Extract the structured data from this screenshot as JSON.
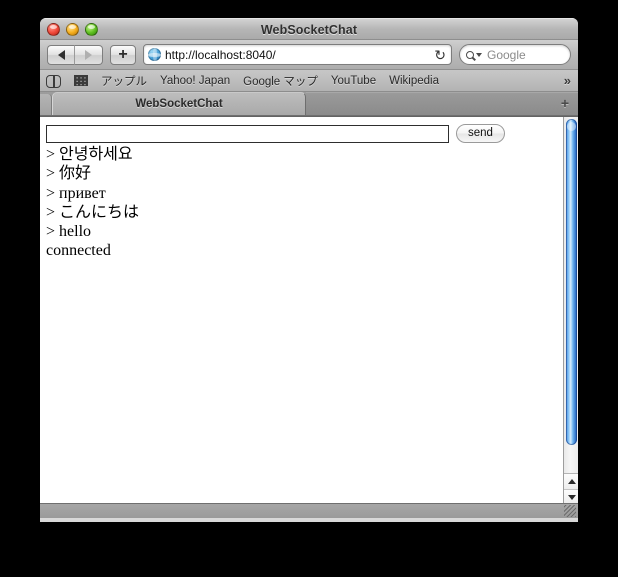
{
  "window": {
    "title": "WebSocketChat",
    "controls": {
      "close": "close-button",
      "minimize": "minimize-button",
      "zoom": "zoom-button"
    }
  },
  "toolbar": {
    "back_label": "◀",
    "forward_label": "▶",
    "add_bookmark_label": "+",
    "url": "http://localhost:8040/",
    "reload_label": "↻",
    "search_placeholder": "Google"
  },
  "bookmarks_bar": {
    "icons": [
      "book-icon",
      "grid-icon"
    ],
    "items": [
      {
        "label": "アップル"
      },
      {
        "label": "Yahoo! Japan"
      },
      {
        "label": "Google マップ"
      },
      {
        "label": "YouTube"
      },
      {
        "label": "Wikipedia"
      }
    ],
    "overflow_label": "»"
  },
  "tabs": {
    "active": {
      "label": "WebSocketChat"
    },
    "new_tab_label": "+"
  },
  "page": {
    "input_value": "",
    "input_placeholder": "",
    "send_label": "send",
    "log": [
      "> 안녕하세요",
      "> 你好",
      "> привет",
      "> こんにちは",
      "> hello",
      "connected"
    ]
  },
  "scrollbar": {
    "up_label": "▲",
    "down_label": "▼"
  },
  "colors": {
    "scroll_thumb": "#4f8fe0",
    "close": "#f24b3c",
    "minimize": "#f6b01f",
    "zoom": "#62c223"
  }
}
